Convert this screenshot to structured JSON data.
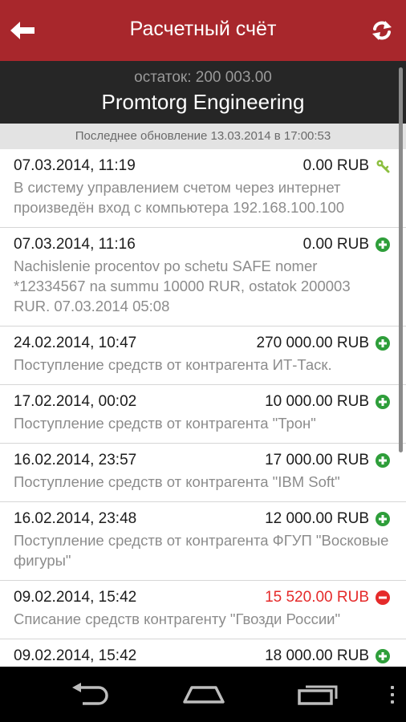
{
  "header": {
    "title": "Расчетный счёт",
    "back_icon": "arrow-left-icon",
    "refresh_icon": "refresh-icon"
  },
  "account": {
    "balance": "остаток: 200 003.00",
    "name": "Promtorg Engineering"
  },
  "last_update": "Последнее обновление 13.03.2014 в 17:00:53",
  "transactions": [
    {
      "date": "07.03.2014, 11:19",
      "amount": "0.00 RUB",
      "type": "key",
      "description": "В систему управлением счетом через интернет произведён вход с компьютера 192.168.100.100"
    },
    {
      "date": "07.03.2014, 11:16",
      "amount": "0.00 RUB",
      "type": "income",
      "description": "Nachislenie procentov po schetu SAFE nomer *12334567 na summu 10000 RUR, ostatok 200003 RUR. 07.03.2014 05:08"
    },
    {
      "date": "24.02.2014, 10:47",
      "amount": "270 000.00 RUB",
      "type": "income",
      "description": "Поступление средств от контрагента ИТ-Таск."
    },
    {
      "date": "17.02.2014, 00:02",
      "amount": "10 000.00 RUB",
      "type": "income",
      "description": "Поступление средств от контрагента \"Трон\""
    },
    {
      "date": "16.02.2014, 23:57",
      "amount": "17 000.00 RUB",
      "type": "income",
      "description": "Поступление средств от контрагента \"IBM Soft\""
    },
    {
      "date": "16.02.2014, 23:48",
      "amount": "12 000.00 RUB",
      "type": "income",
      "description": "Поступление средств от контрагента ФГУП \"Восковые фигуры\""
    },
    {
      "date": "09.02.2014, 15:42",
      "amount": "15 520.00 RUB",
      "type": "expense",
      "description": "Списание средств контрагенту \"Гвозди России\""
    },
    {
      "date": "09.02.2014, 15:42",
      "amount": "18 000.00 RUB",
      "type": "income",
      "description": ""
    }
  ],
  "colors": {
    "appbar": "#a8272c",
    "income_icon": "#2e9e3a",
    "expense_icon": "#e52a2a",
    "expense_text": "#e52a2a",
    "key_icon": "#8cbf3f"
  },
  "navigation": {
    "back_icon": "nav-back-icon",
    "home_icon": "nav-home-icon",
    "recents_icon": "nav-recents-icon",
    "menu_icon": "overflow-menu-icon"
  }
}
